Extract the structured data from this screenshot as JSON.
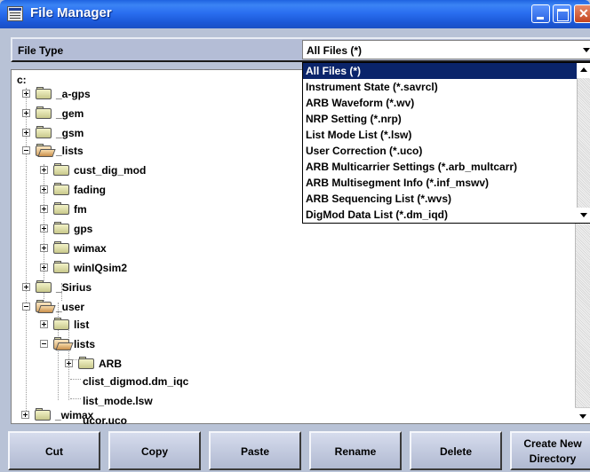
{
  "window": {
    "title": "File Manager"
  },
  "filetype": {
    "label": "File Type",
    "selected": "All Files (*)"
  },
  "dropdown": {
    "options": [
      "All Files (*)",
      "Instrument State (*.savrcl)",
      "ARB Waveform (*.wv)",
      "NRP Setting (*.nrp)",
      "List Mode List (*.lsw)",
      "User Correction (*.uco)",
      "ARB Multicarrier Settings (*.arb_multcarr)",
      "ARB Multisegment Info (*.inf_mswv)",
      "ARB Sequencing List (*.wvs)",
      "DigMod Data List (*.dm_iqd)"
    ]
  },
  "tree": {
    "drive": "c:",
    "items": [
      {
        "label": "_a-gps"
      },
      {
        "label": "_gem"
      },
      {
        "label": "_gsm"
      },
      {
        "label": "_lists"
      },
      {
        "label": "cust_dig_mod"
      },
      {
        "label": "fading"
      },
      {
        "label": "fm"
      },
      {
        "label": "gps"
      },
      {
        "label": "wimax"
      },
      {
        "label": "winIQsim2"
      },
      {
        "label": "_Sirius"
      },
      {
        "label": "_user"
      },
      {
        "label": "list"
      },
      {
        "label": "lists"
      },
      {
        "label": "ARB"
      },
      {
        "label": "clist_digmod.dm_iqc"
      },
      {
        "label": "list_mode.lsw"
      },
      {
        "label": "ucor.uco"
      },
      {
        "label": "_wimax"
      }
    ]
  },
  "buttons": {
    "cut": "Cut",
    "copy": "Copy",
    "paste": "Paste",
    "rename": "Rename",
    "delete": "Delete",
    "create_line1": "Create New",
    "create_line2": "Directory"
  }
}
